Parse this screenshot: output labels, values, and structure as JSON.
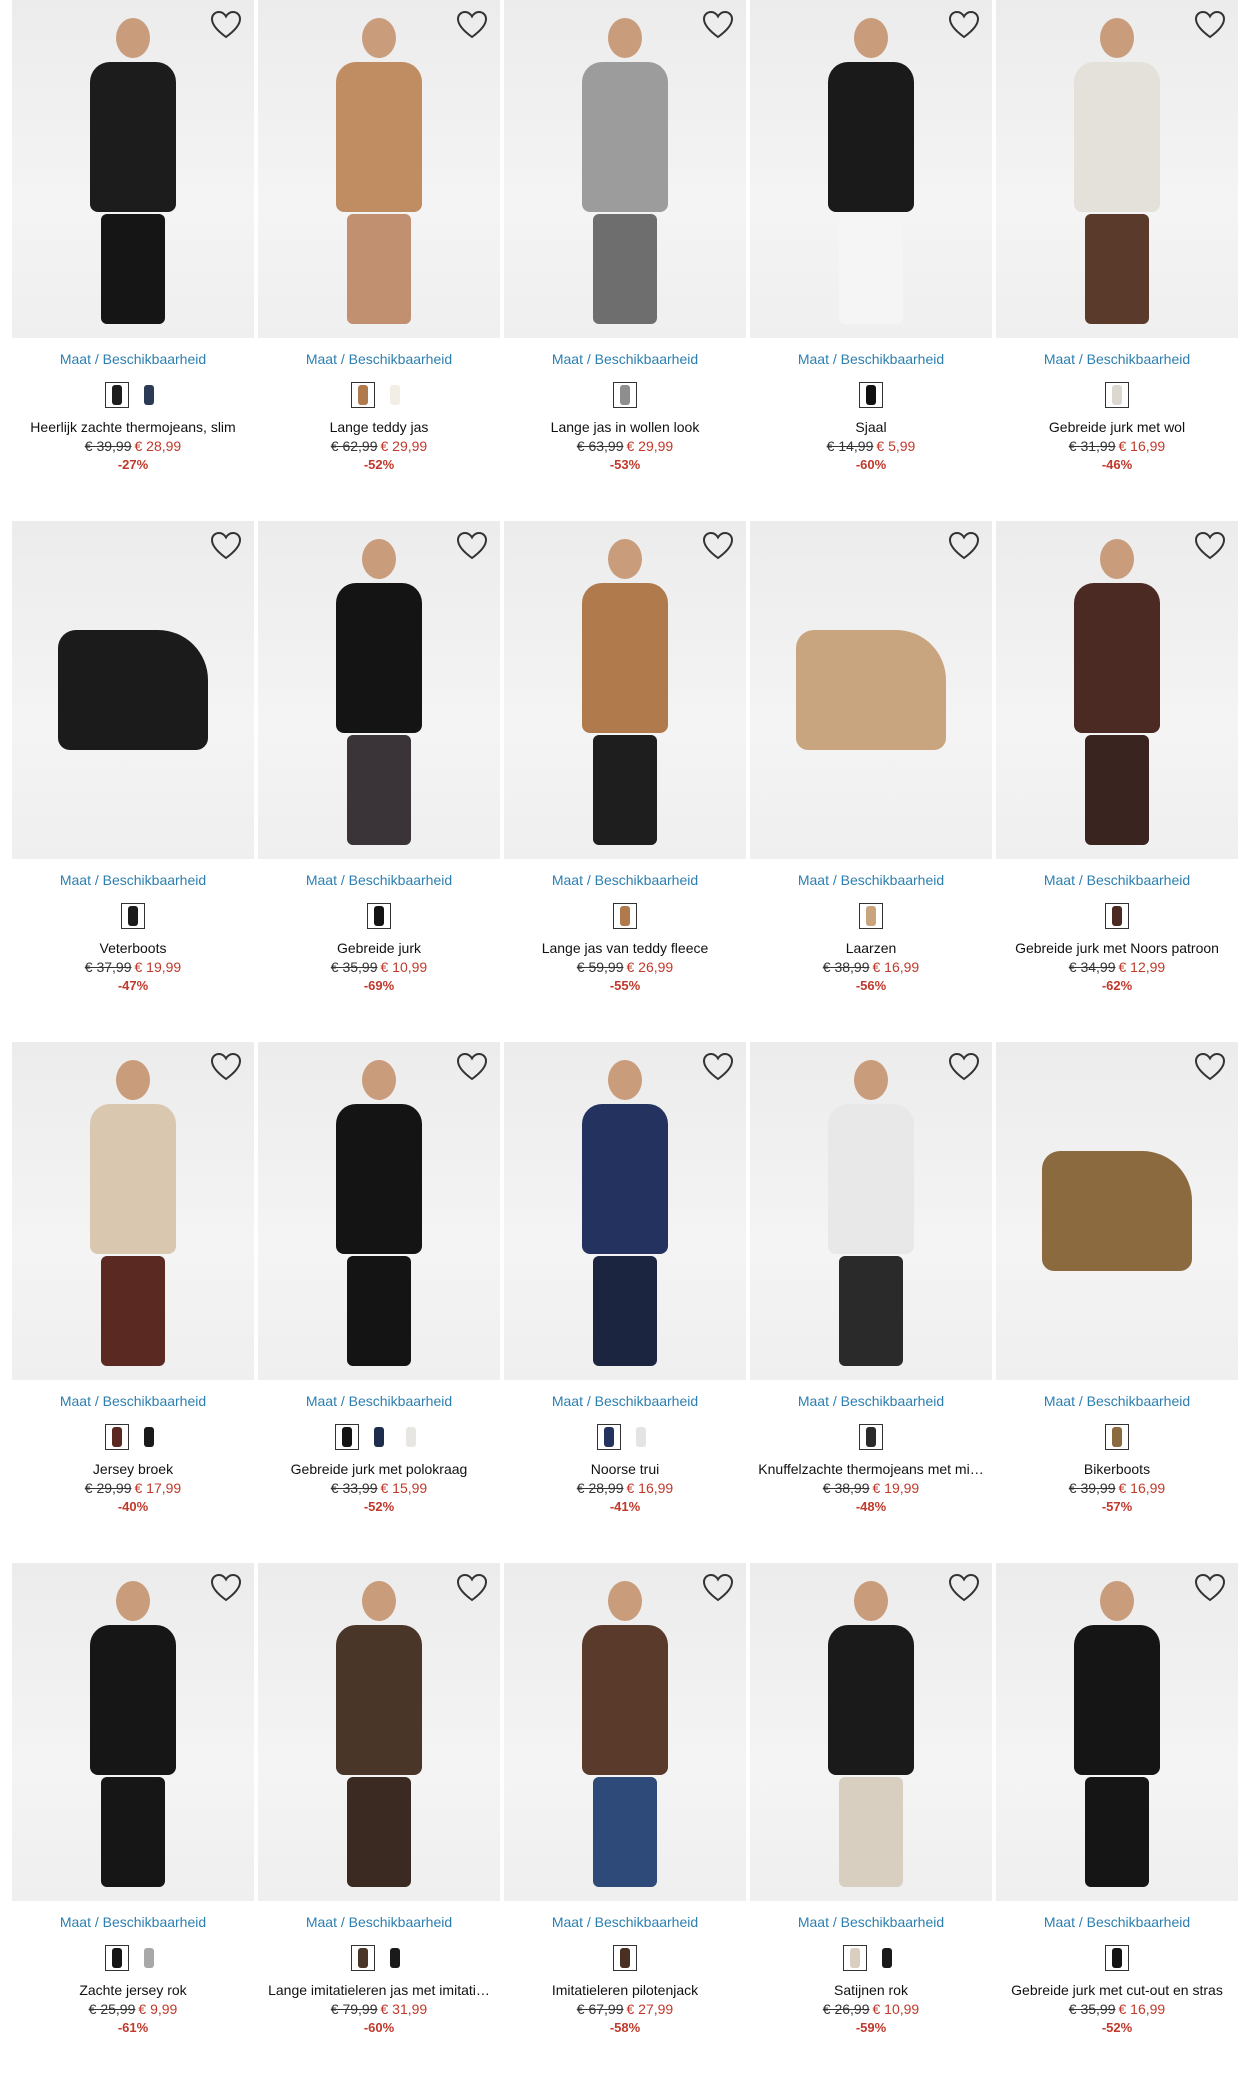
{
  "colors": {
    "link": "#2c7fb0",
    "sale": "#c0392b",
    "text": "#111111"
  },
  "size_link_label": "Maat / Beschikbaarheid",
  "products": [
    {
      "title": "Heerlijk zachte thermojeans, slim",
      "old_price": "€ 39,99",
      "new_price": "€ 28,99",
      "discount": "-27%",
      "kind": "model",
      "main": "#1c1c1c",
      "legs": "#151515",
      "swatches": [
        "#1e1e1e",
        "#2b3a55"
      ]
    },
    {
      "title": "Lange teddy jas",
      "old_price": "€ 62,99",
      "new_price": "€ 29,99",
      "discount": "-52%",
      "kind": "model",
      "main": "#c08c62",
      "legs": "#c09070",
      "swatches": [
        "#b07a4d",
        "#f2eee6"
      ]
    },
    {
      "title": "Lange jas in wollen look",
      "old_price": "€ 63,99",
      "new_price": "€ 29,99",
      "discount": "-53%",
      "kind": "model",
      "main": "#9c9c9c",
      "legs": "#6e6e6e",
      "swatches": [
        "#8e8e8e"
      ]
    },
    {
      "title": "Sjaal",
      "old_price": "€ 14,99",
      "new_price": "€ 5,99",
      "discount": "-60%",
      "kind": "model",
      "main": "#1a1a1a",
      "legs": "#f5f5f5",
      "swatches": [
        "#111111"
      ]
    },
    {
      "title": "Gebreide jurk met wol",
      "old_price": "€ 31,99",
      "new_price": "€ 16,99",
      "discount": "-46%",
      "kind": "model",
      "main": "#e4e0da",
      "legs": "#5a3a2a",
      "swatches": [
        "#dcd8d0"
      ]
    },
    {
      "title": "Veterboots",
      "old_price": "€ 37,99",
      "new_price": "€ 19,99",
      "discount": "-47%",
      "kind": "product",
      "main": "#1b1b1b",
      "legs": "#1b1b1b",
      "swatches": [
        "#1b1b1b"
      ]
    },
    {
      "title": "Gebreide jurk",
      "old_price": "€ 35,99",
      "new_price": "€ 10,99",
      "discount": "-69%",
      "kind": "model",
      "main": "#141414",
      "legs": "#3a3338",
      "swatches": [
        "#141414"
      ]
    },
    {
      "title": "Lange jas van teddy fleece",
      "old_price": "€ 59,99",
      "new_price": "€ 26,99",
      "discount": "-55%",
      "kind": "model",
      "main": "#b07a4c",
      "legs": "#1e1e1e",
      "swatches": [
        "#b07a4c"
      ]
    },
    {
      "title": "Laarzen",
      "old_price": "€ 38,99",
      "new_price": "€ 16,99",
      "discount": "-56%",
      "kind": "product",
      "main": "#c9a57f",
      "legs": "#c9a57f",
      "swatches": [
        "#c9a57f"
      ]
    },
    {
      "title": "Gebreide jurk met Noors patroon",
      "old_price": "€ 34,99",
      "new_price": "€ 12,99",
      "discount": "-62%",
      "kind": "model",
      "main": "#4a2a22",
      "legs": "#3a2420",
      "swatches": [
        "#4a2a22"
      ]
    },
    {
      "title": "Jersey broek",
      "old_price": "€ 29,99",
      "new_price": "€ 17,99",
      "discount": "-40%",
      "kind": "model",
      "main": "#d9c7b0",
      "legs": "#5a2a22",
      "swatches": [
        "#5a2a22",
        "#1a1a1a"
      ]
    },
    {
      "title": "Gebreide jurk met polokraag",
      "old_price": "€ 33,99",
      "new_price": "€ 15,99",
      "discount": "-52%",
      "kind": "model",
      "main": "#141414",
      "legs": "#141414",
      "swatches": [
        "#141414",
        "#1f2d4d",
        "#e8e6e2"
      ]
    },
    {
      "title": "Noorse trui",
      "old_price": "€ 28,99",
      "new_price": "€ 16,99",
      "discount": "-41%",
      "kind": "model",
      "main": "#23325e",
      "legs": "#1c2540",
      "swatches": [
        "#23325e",
        "#e4e4e4"
      ]
    },
    {
      "title": "Knuffelzachte thermojeans met mi…",
      "old_price": "€ 38,99",
      "new_price": "€ 19,99",
      "discount": "-48%",
      "kind": "model",
      "main": "#e8e8e8",
      "legs": "#2a2a2a",
      "swatches": [
        "#2a2a2a"
      ]
    },
    {
      "title": "Bikerboots",
      "old_price": "€ 39,99",
      "new_price": "€ 16,99",
      "discount": "-57%",
      "kind": "product",
      "main": "#8c6a40",
      "legs": "#8c6a40",
      "swatches": [
        "#8c6a40"
      ]
    },
    {
      "title": "Zachte jersey rok",
      "old_price": "€ 25,99",
      "new_price": "€ 9,99",
      "discount": "-61%",
      "kind": "model",
      "main": "#161616",
      "legs": "#161616",
      "swatches": [
        "#161616",
        "#a8a8a8"
      ]
    },
    {
      "title": "Lange imitatieleren jas met imitati…",
      "old_price": "€ 79,99",
      "new_price": "€ 31,99",
      "discount": "-60%",
      "kind": "model",
      "main": "#4a3628",
      "legs": "#3a2a22",
      "swatches": [
        "#4a3628",
        "#1a1a1a"
      ]
    },
    {
      "title": "Imitatieleren pilotenjack",
      "old_price": "€ 67,99",
      "new_price": "€ 27,99",
      "discount": "-58%",
      "kind": "model",
      "main": "#5a3a2a",
      "legs": "#2e4a78",
      "swatches": [
        "#4a3022"
      ]
    },
    {
      "title": "Satijnen rok",
      "old_price": "€ 26,99",
      "new_price": "€ 10,99",
      "discount": "-59%",
      "kind": "model",
      "main": "#1a1a1a",
      "legs": "#d8cfc0",
      "swatches": [
        "#d8cfc0",
        "#1a1a1a"
      ]
    },
    {
      "title": "Gebreide jurk met cut-out en stras",
      "old_price": "€ 35,99",
      "new_price": "€ 16,99",
      "discount": "-52%",
      "kind": "model",
      "main": "#151515",
      "legs": "#151515",
      "swatches": [
        "#151515"
      ]
    }
  ]
}
